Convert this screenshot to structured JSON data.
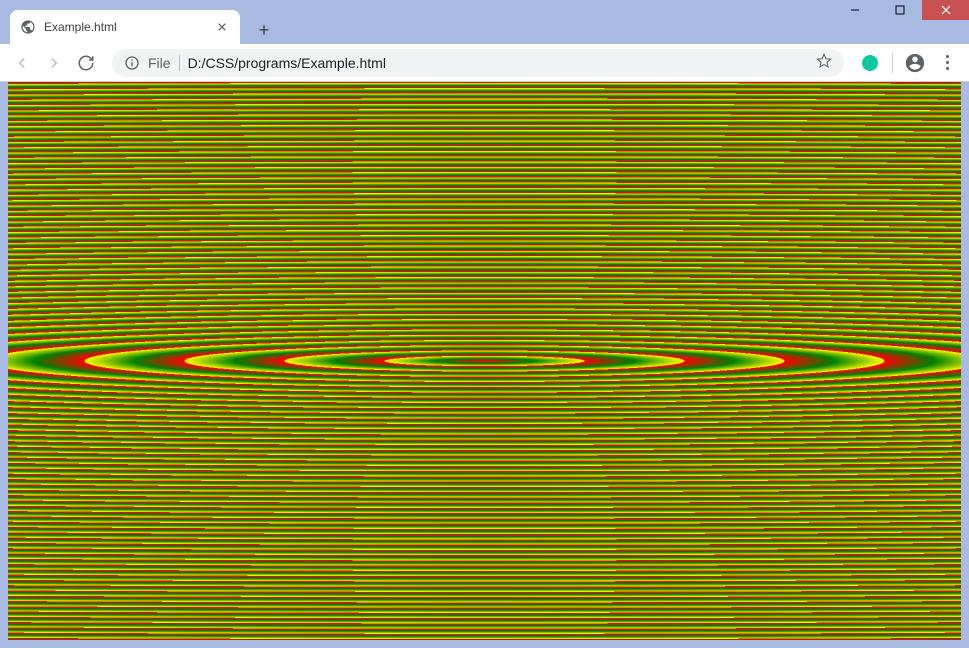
{
  "window": {
    "minimize_label": "Minimize",
    "maximize_label": "Maximize",
    "close_label": "Close"
  },
  "tab": {
    "title": "Example.html"
  },
  "toolbar": {
    "file_label": "File",
    "url": "D:/CSS/programs/Example.html"
  }
}
